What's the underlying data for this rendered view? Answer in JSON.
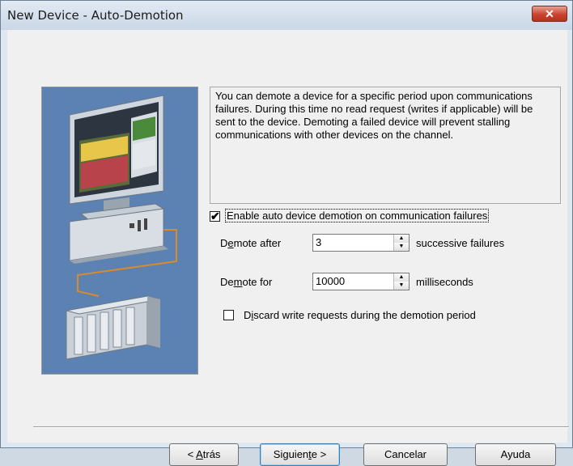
{
  "window": {
    "title": "New Device - Auto-Demotion",
    "close_label": "✕"
  },
  "description": "You can demote a device for a specific period upon communications failures. During this time no read request (writes if applicable) will be sent to the device. Demoting a failed device will prevent stalling communications with other devices on the channel.",
  "enable": {
    "label": "Enable auto device demotion on communication failures",
    "checked": true,
    "check_glyph": "✔"
  },
  "demote_after": {
    "label_pre": "D",
    "label_acc": "e",
    "label_post": "mote after",
    "value": "3",
    "unit": "successive failures"
  },
  "demote_for": {
    "label_pre": "De",
    "label_acc": "m",
    "label_post": "ote for",
    "value": "10000",
    "unit": "milliseconds"
  },
  "discard": {
    "label_pre": "D",
    "label_acc": "i",
    "label_post": "scard write requests during the demotion period",
    "checked": false
  },
  "buttons": {
    "back_pre": "< ",
    "back_acc": "A",
    "back_post": "trás",
    "next_pre": "Siguien",
    "next_acc": "t",
    "next_post": "e >",
    "cancel": "Cancelar",
    "help": "Ayuda"
  },
  "colors": {
    "illustration_bg": "#5b82b3",
    "close_button": "#c9452f",
    "title_bar": "#d4dfeb"
  }
}
